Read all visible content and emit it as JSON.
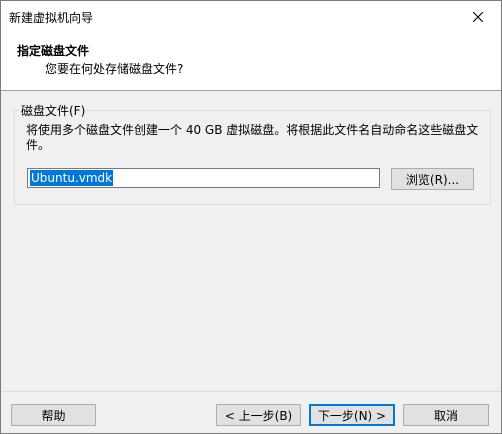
{
  "window": {
    "title": "新建虚拟机向导"
  },
  "header": {
    "title": "指定磁盘文件",
    "subtitle": "您要在何处存储磁盘文件?"
  },
  "disk_file_group": {
    "label": "磁盘文件(F)",
    "description": "将使用多个磁盘文件创建一个 40 GB 虚拟磁盘。将根据此文件名自动命名这些磁盘文件。",
    "filename_value": "Ubuntu.vmdk",
    "browse_label": "浏览(R)..."
  },
  "footer": {
    "help_label": "帮助",
    "back_label": "< 上一步(B)",
    "next_label": "下一步(N) >",
    "cancel_label": "取消"
  },
  "colors": {
    "selection": "#0078d7",
    "window_bg": "#f0f0f0",
    "header_bg": "#ffffff"
  },
  "icons": {
    "close": "close-icon"
  }
}
